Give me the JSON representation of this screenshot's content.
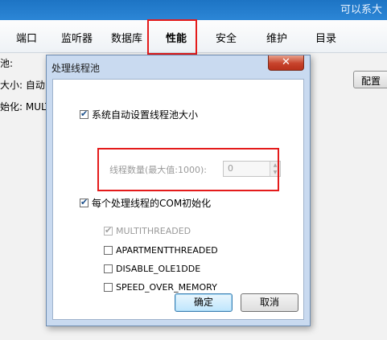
{
  "window": {
    "title_partial": "可以系大"
  },
  "tabs": [
    {
      "label": "端口"
    },
    {
      "label": "监听器"
    },
    {
      "label": "数据库"
    },
    {
      "label": "性能"
    },
    {
      "label": "安全"
    },
    {
      "label": "维护"
    },
    {
      "label": "目录"
    }
  ],
  "active_tab": "性能",
  "background": {
    "row1": "池:",
    "row2": "大小:  自动",
    "row3": "始化:  MULTI",
    "config_button": "配置"
  },
  "dialog": {
    "title": "处理线程池",
    "close_glyph": "✕",
    "auto_size": {
      "label": "系统自动设置线程池大小",
      "checked": true
    },
    "thread_count": {
      "label": "线程数量(最大值:1000):",
      "value": "0",
      "enabled": false
    },
    "com_init": {
      "label": "每个处理线程的COM初始化",
      "checked": true
    },
    "options": [
      {
        "label": "MULTITHREADED",
        "checked": true,
        "disabled": true
      },
      {
        "label": "APARTMENTTHREADED",
        "checked": false,
        "disabled": false
      },
      {
        "label": "DISABLE_OLE1DDE",
        "checked": false,
        "disabled": false
      },
      {
        "label": "SPEED_OVER_MEMORY",
        "checked": false,
        "disabled": false
      }
    ],
    "ok_label": "确定",
    "cancel_label": "取消"
  },
  "colors": {
    "highlight": "#e41b1b",
    "titlebar": "#1d74c4",
    "dialog_frame": "#c9daf0"
  }
}
